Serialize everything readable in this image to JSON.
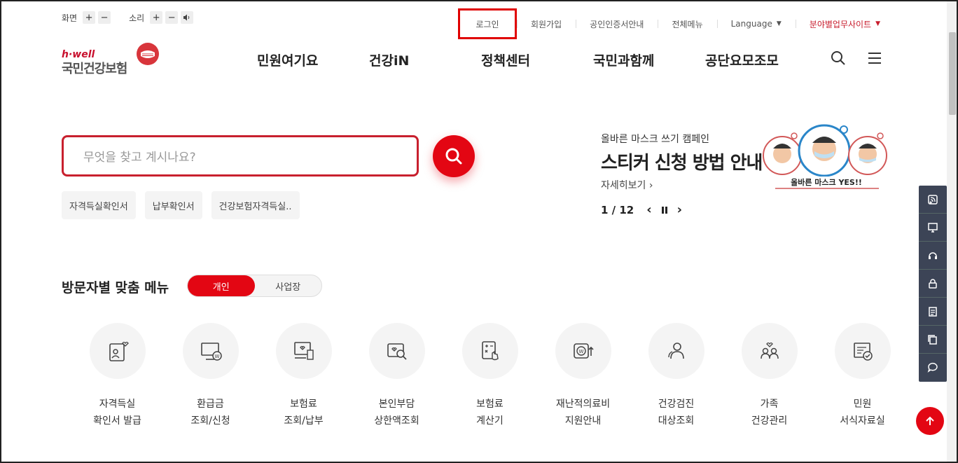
{
  "util": {
    "screen_label": "화면",
    "sound_label": "소리",
    "plus": "+",
    "minus": "−"
  },
  "topnav": {
    "login": "로그인",
    "signup": "회원가입",
    "cert": "공인인증서안내",
    "all_menu": "전체메뉴",
    "language": "Language",
    "site": "분야별업무사이트"
  },
  "logo": {
    "en": "h·well",
    "ko": "국민건강보험"
  },
  "gnb": [
    "민원여기요",
    "건강iN",
    "정책센터",
    "국민과함께",
    "공단요모조모"
  ],
  "search": {
    "placeholder": "무엇을 찾고 계시나요?"
  },
  "chips": [
    "자격득실확인서",
    "납부확인서",
    "건강보험자격득실.."
  ],
  "banner": {
    "sub": "올바른 마스크 쓰기 캠페인",
    "title": "스티커 신청 방법 안내",
    "more": "자세히보기 ›",
    "page": "1 / 12",
    "img_caption": "올바른 마스크 YES!!"
  },
  "visitor": {
    "title": "방문자별 맞춤 메뉴",
    "tab_personal": "개인",
    "tab_business": "사업장"
  },
  "quick_menu": [
    {
      "line1": "자격득실",
      "line2": "확인서 발급",
      "icon": "id-card-heart-icon"
    },
    {
      "line1": "환급금",
      "line2": "조회/신청",
      "icon": "monitor-won-icon"
    },
    {
      "line1": "보험료",
      "line2": "조회/납부",
      "icon": "screen-bill-icon"
    },
    {
      "line1": "본인부담",
      "line2": "상한액조회",
      "icon": "search-heart-icon"
    },
    {
      "line1": "보험료",
      "line2": "계산기",
      "icon": "calculator-icon"
    },
    {
      "line1": "재난적의료비",
      "line2": "지원안내",
      "icon": "coin-won-icon"
    },
    {
      "line1": "건강검진",
      "line2": "대상조회",
      "icon": "people-icon"
    },
    {
      "line1": "가족",
      "line2": "건강관리",
      "icon": "family-heart-icon"
    },
    {
      "line1": "민원",
      "line2": "서식자료실",
      "icon": "document-check-icon"
    }
  ],
  "colors": {
    "brand": "#e30613",
    "dark": "#3c4456"
  }
}
